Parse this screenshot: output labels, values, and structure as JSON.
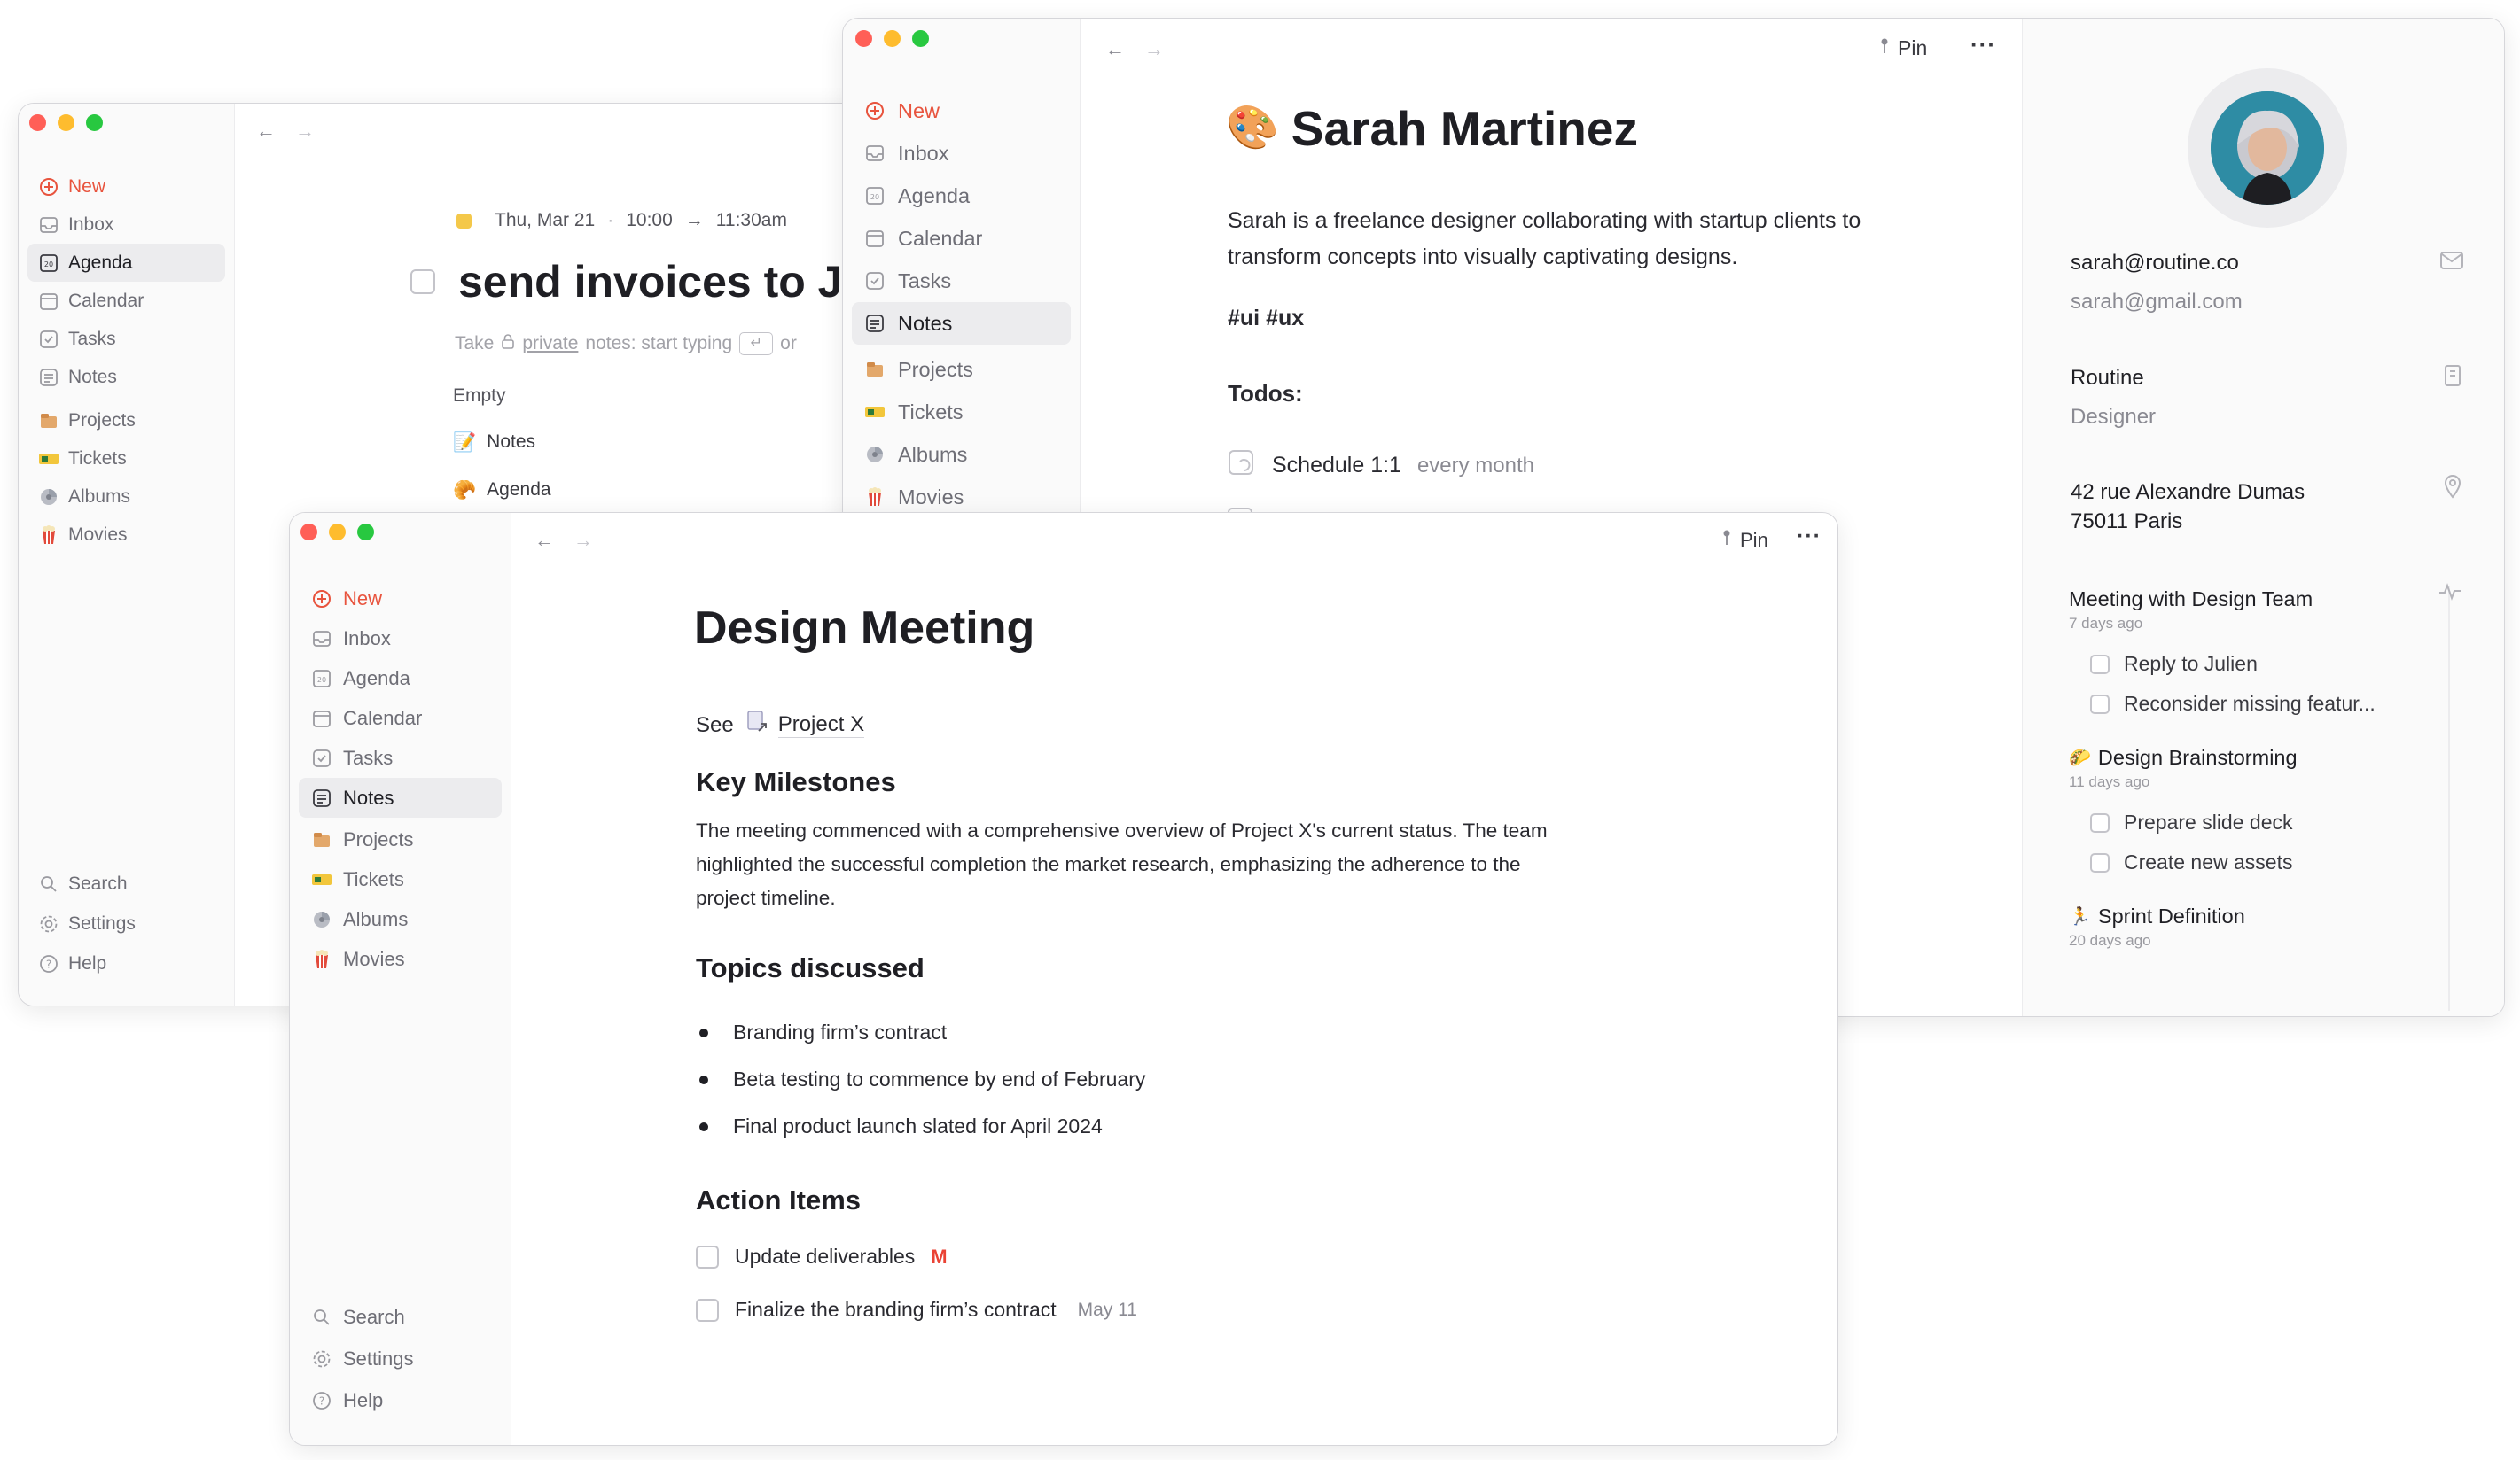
{
  "windows": {
    "left": {
      "sidebar": {
        "new": "New",
        "items": [
          "Inbox",
          "Agenda",
          "Calendar",
          "Tasks",
          "Notes",
          "Projects",
          "Tickets",
          "Albums",
          "Movies"
        ],
        "footer": [
          "Search",
          "Settings",
          "Help"
        ]
      },
      "event": {
        "date": "Thu, Mar 21",
        "separator": "·",
        "start": "10:00",
        "arrow": "→",
        "end": "11:30am",
        "title": "send invoices to Ju",
        "notes_prompt_a": "Take",
        "notes_prompt_private": "private",
        "notes_prompt_b": "notes: start typing",
        "notes_prompt_c": "or",
        "empty": "Empty",
        "links": [
          "Notes",
          "Agenda"
        ]
      }
    },
    "right": {
      "sidebar": {
        "new": "New",
        "items": [
          "Inbox",
          "Agenda",
          "Calendar",
          "Tasks",
          "Notes",
          "Projects",
          "Tickets",
          "Albums",
          "Movies"
        ]
      },
      "toolbar": {
        "pin": "Pin",
        "more": "···"
      },
      "contact": {
        "emoji": "🎨",
        "name": "Sarah Martinez",
        "bio_1": "Sarah is a freelance designer collaborating with startup clients to",
        "bio_2": "transform concepts into visually captivating designs.",
        "tags": "#ui #ux",
        "todos_heading": "Todos:",
        "todo_1": "Schedule 1:1",
        "todo_1_repeat": "every month"
      },
      "panel": {
        "email_primary": "sarah@routine.co",
        "email_secondary": "sarah@gmail.com",
        "company": "Routine",
        "role": "Designer",
        "address_1": "42 rue Alexandre Dumas",
        "address_2": "75011 Paris",
        "activities": [
          {
            "title": "Meeting with Design Team",
            "time": "7 days ago",
            "tasks": [
              "Reply to Julien",
              "Reconsider missing featur..."
            ]
          },
          {
            "emoji": "🌮",
            "title": "Design Brainstorming",
            "time": "11 days ago",
            "tasks": [
              "Prepare slide deck",
              "Create new assets"
            ]
          },
          {
            "emoji": "🏃",
            "title": "Sprint Definition",
            "time": "20 days ago",
            "tasks": []
          }
        ]
      }
    },
    "front": {
      "sidebar": {
        "new": "New",
        "items": [
          "Inbox",
          "Agenda",
          "Calendar",
          "Tasks",
          "Notes",
          "Projects",
          "Tickets",
          "Albums",
          "Movies"
        ],
        "footer": [
          "Search",
          "Settings",
          "Help"
        ]
      },
      "toolbar": {
        "pin": "Pin",
        "more": "···"
      },
      "doc": {
        "title": "Design Meeting",
        "see_label": "See",
        "see_link": "Project X",
        "h_milestones": "Key Milestones",
        "p1_1": "The meeting commenced with a comprehensive overview of Project X's current status. The team",
        "p1_2": "highlighted the successful completion the market research, emphasizing the adherence to the",
        "p1_3": "project timeline.",
        "h_topics": "Topics discussed",
        "topics": [
          "Branding firm’s contract",
          "Beta testing to commence by end of February",
          "Final product launch slated for April 2024"
        ],
        "h_actions": "Action Items",
        "action_1": "Update deliverables",
        "action_1_badge": "M",
        "action_2": "Finalize the branding firm’s contract",
        "action_2_date": "May 11"
      }
    }
  },
  "colors": {
    "accent_new": "#e8543e",
    "text": "#1f1f24",
    "muted": "#8a8a92",
    "gmail_red": "#ea4335"
  },
  "icons": [
    "plus-circle-icon",
    "inbox-icon",
    "agenda-icon",
    "calendar-icon",
    "tasks-icon",
    "notes-icon",
    "projects-icon",
    "tickets-icon",
    "albums-icon",
    "movies-icon",
    "search-icon",
    "settings-icon",
    "help-icon",
    "pin-icon",
    "more-icon",
    "back-arrow-icon",
    "forward-arrow-icon",
    "mail-icon",
    "building-icon",
    "location-icon",
    "activity-icon",
    "gmail-icon",
    "link-icon",
    "repeat-checkbox-icon"
  ]
}
